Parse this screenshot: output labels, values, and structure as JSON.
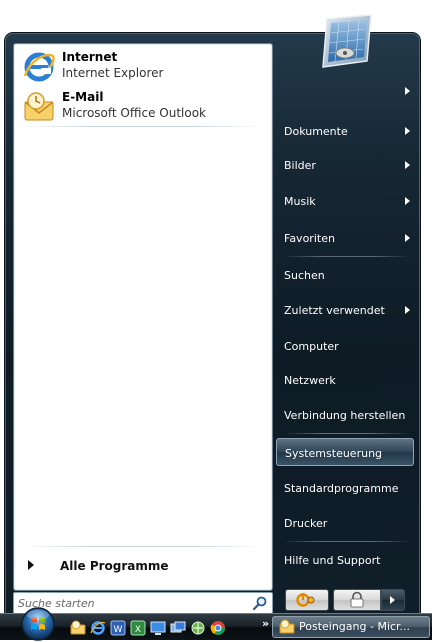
{
  "pinned": [
    {
      "title": "Internet",
      "subtitle": "Internet Explorer",
      "icon": "internet-explorer-icon"
    },
    {
      "title": "E-Mail",
      "subtitle": "Microsoft Office Outlook",
      "icon": "outlook-icon"
    }
  ],
  "all_programs_label": "Alle Programme",
  "search": {
    "placeholder": "Suche starten",
    "value": ""
  },
  "right_menu": [
    {
      "label": "Dokumente",
      "submenu": true
    },
    {
      "label": "Bilder",
      "submenu": true
    },
    {
      "label": "Musik",
      "submenu": true
    },
    {
      "label": "Favoriten",
      "submenu": true
    },
    {
      "label": "Suchen",
      "submenu": false
    },
    {
      "label": "Zuletzt verwendet",
      "submenu": true
    },
    {
      "label": "Computer",
      "submenu": false
    },
    {
      "label": "Netzwerk",
      "submenu": false
    },
    {
      "label": "Verbindung herstellen",
      "submenu": false
    },
    {
      "label": "Systemsteuerung",
      "submenu": false,
      "highlighted": true
    },
    {
      "label": "Standardprogramme",
      "submenu": false
    },
    {
      "label": "Drucker",
      "submenu": false
    },
    {
      "label": "Hilfe und Support",
      "submenu": false
    }
  ],
  "taskbar": {
    "quick_launch": [
      "outlook-icon",
      "internet-explorer-icon",
      "word-icon",
      "excel-icon",
      "desktop-icon",
      "window-switch-icon",
      "network-icon",
      "chrome-icon"
    ],
    "overflow": "»",
    "active_task": "Posteingang - Micr..."
  },
  "colors": {
    "menu_dark": "#162734",
    "highlight": "#3b5366",
    "left_panel": "#ffffff",
    "taskbar": "#1a2229"
  }
}
